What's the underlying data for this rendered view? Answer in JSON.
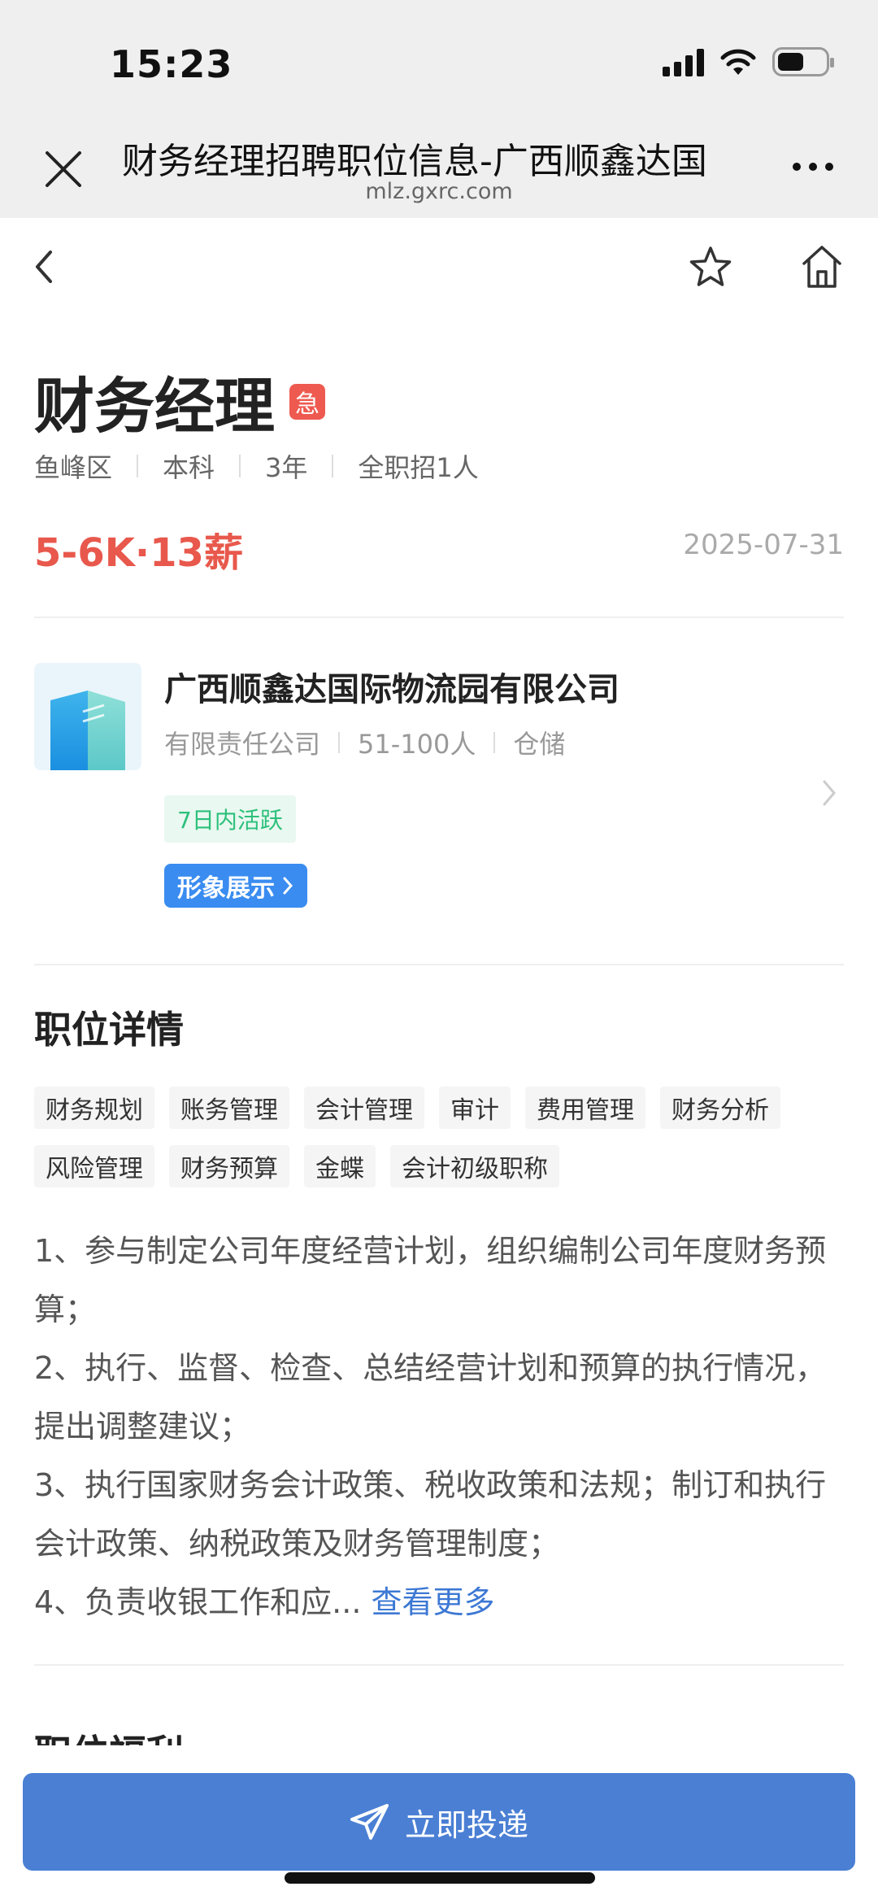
{
  "status_bar": {
    "time": "15:23"
  },
  "browser": {
    "title": "财务经理招聘职位信息-广西顺鑫达国",
    "url": "mlz.gxrc.com"
  },
  "job": {
    "title": "财务经理",
    "urgent_badge": "急",
    "meta": [
      "鱼峰区",
      "本科",
      "3年",
      "全职招1人"
    ],
    "salary": "5-6K·13薪",
    "date": "2025-07-31"
  },
  "company": {
    "name": "广西顺鑫达国际物流园有限公司",
    "meta": [
      "有限责任公司",
      "51-100人",
      "仓储"
    ],
    "active_badge": "7日内活跃",
    "brand_button": "形象展示"
  },
  "details": {
    "section_title": "职位详情",
    "tags": [
      "财务规划",
      "账务管理",
      "会计管理",
      "审计",
      "费用管理",
      "财务分析",
      "风险管理",
      "财务预算",
      "金蝶",
      "会计初级职称"
    ],
    "description": [
      "1、参与制定公司年度经营计划，组织编制公司年度财务预算；",
      "2、执行、监督、检查、总结经营计划和预算的执行情况，提出调整建议；",
      "3、执行国家财务会计政策、税收政策和法规；制订和执行会计政策、纳税政策及财务管理制度；",
      "4、负责收银工作和应..."
    ],
    "more_link": "查看更多"
  },
  "next_section_title": "职位福利",
  "apply_button": "立即投递",
  "colors": {
    "accent": "#4a7fd4",
    "salary": "#e8584c",
    "urgent": "#ee5a50",
    "active": "#2cc07b"
  }
}
